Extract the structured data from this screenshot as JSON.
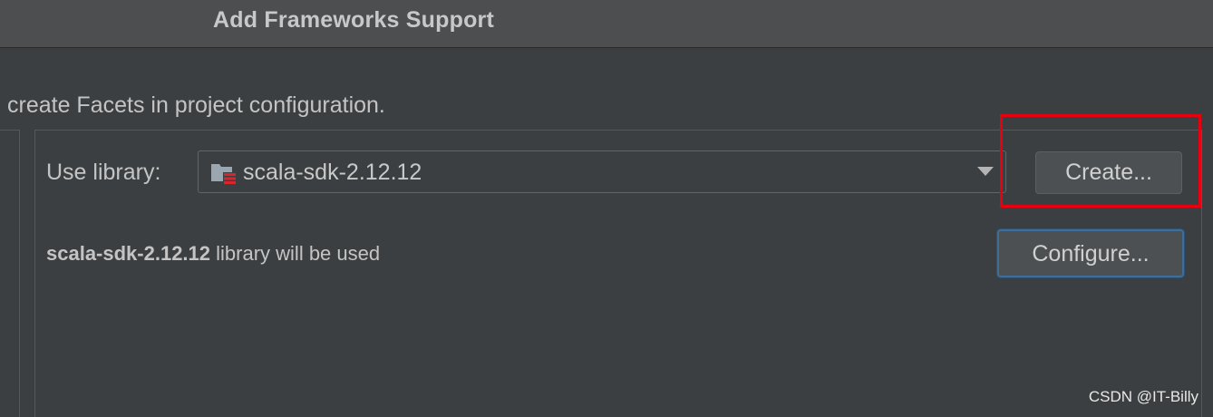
{
  "window": {
    "title": "Add Frameworks Support"
  },
  "description": "create Facets in project configuration.",
  "library": {
    "label": "Use library:",
    "selected": "scala-sdk-2.12.12",
    "icon": "folder-library-icon"
  },
  "buttons": {
    "create": "Create...",
    "configure": "Configure..."
  },
  "usage": {
    "library_name": "scala-sdk-2.12.12",
    "suffix": " library will be used"
  },
  "watermark": "CSDN @IT-Billy",
  "colors": {
    "highlight": "#e8000f",
    "focus_border": "#3e6d96",
    "background": "#3c3f41"
  }
}
